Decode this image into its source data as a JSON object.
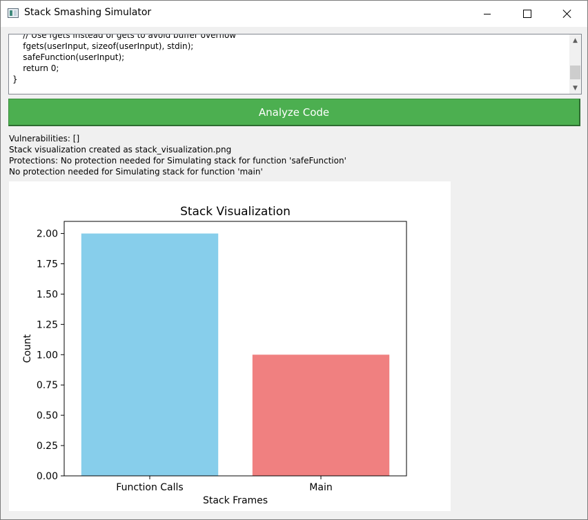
{
  "window": {
    "title": "Stack Smashing Simulator"
  },
  "code_editor": {
    "lines": [
      "    // Use fgets instead of gets to avoid buffer overflow",
      "    fgets(userInput, sizeof(userInput), stdin);",
      "    safeFunction(userInput);",
      "    return 0;",
      "}"
    ]
  },
  "analyze_button": {
    "label": "Analyze Code",
    "color": "#4caf50"
  },
  "output": {
    "lines": [
      "Vulnerabilities: []",
      "Stack visualization created as stack_visualization.png",
      "Protections: No protection needed for Simulating stack for function 'safeFunction'",
      "No protection needed for Simulating stack for function 'main'"
    ]
  },
  "chart_data": {
    "type": "bar",
    "title": "Stack Visualization",
    "xlabel": "Stack Frames",
    "ylabel": "Count",
    "categories": [
      "Function Calls",
      "Main"
    ],
    "values": [
      2,
      1
    ],
    "colors": [
      "#87ceeb",
      "#f08080"
    ],
    "ylim": [
      0,
      2.1
    ],
    "yticks": [
      "0.00",
      "0.25",
      "0.50",
      "0.75",
      "1.00",
      "1.25",
      "1.50",
      "1.75",
      "2.00"
    ],
    "grid": false
  }
}
